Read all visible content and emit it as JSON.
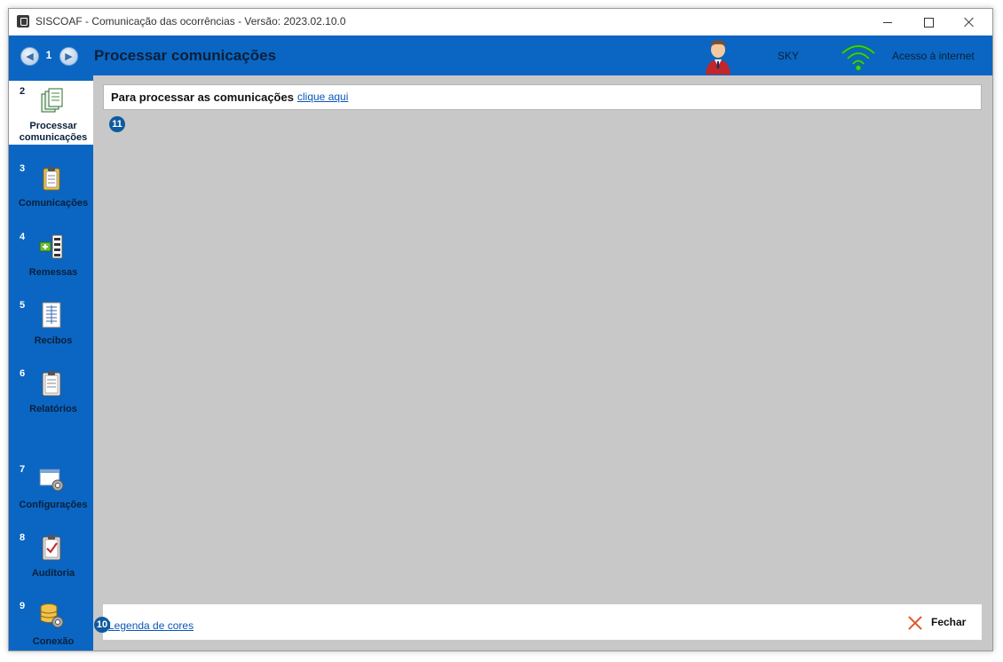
{
  "window": {
    "title": "SISCOAF - Comunicação das ocorrências - Versão: 2023.02.10.0"
  },
  "header": {
    "nav_badge": "1",
    "title": "Processar comunicações",
    "user": "SKY",
    "connection_status": "Acesso à internet"
  },
  "sidebar": {
    "items": [
      {
        "num": "2",
        "line1": "Processar",
        "line2": "comunicações",
        "icon": "documents-stack-icon",
        "active": true
      },
      {
        "num": "3",
        "line1": "Comunicações",
        "line2": "",
        "icon": "clipboard-icon"
      },
      {
        "num": "4",
        "line1": "Remessas",
        "line2": "",
        "icon": "add-list-icon"
      },
      {
        "num": "5",
        "line1": "Recibos",
        "line2": "",
        "icon": "receipt-icon"
      },
      {
        "num": "6",
        "line1": "Relatórios",
        "line2": "",
        "icon": "report-clipboard-icon"
      },
      {
        "num": "7",
        "line1": "Configurações",
        "line2": "",
        "icon": "window-gear-icon"
      },
      {
        "num": "8",
        "line1": "Auditoria",
        "line2": "",
        "icon": "checklist-icon"
      },
      {
        "num": "9",
        "line1": "Conexão",
        "line2": "",
        "icon": "database-gear-icon"
      }
    ]
  },
  "main": {
    "info_text": "Para processar as comunicações",
    "info_link": "clique aqui",
    "badge_content": "11"
  },
  "footer": {
    "badge": "10",
    "legend_link": "Legenda de cores",
    "close_label": "Fechar"
  },
  "colors": {
    "header_blue": "#0a66c2",
    "content_gray": "#c8c8c8",
    "link_blue": "#0a56b8",
    "close_red": "#e0562d"
  }
}
